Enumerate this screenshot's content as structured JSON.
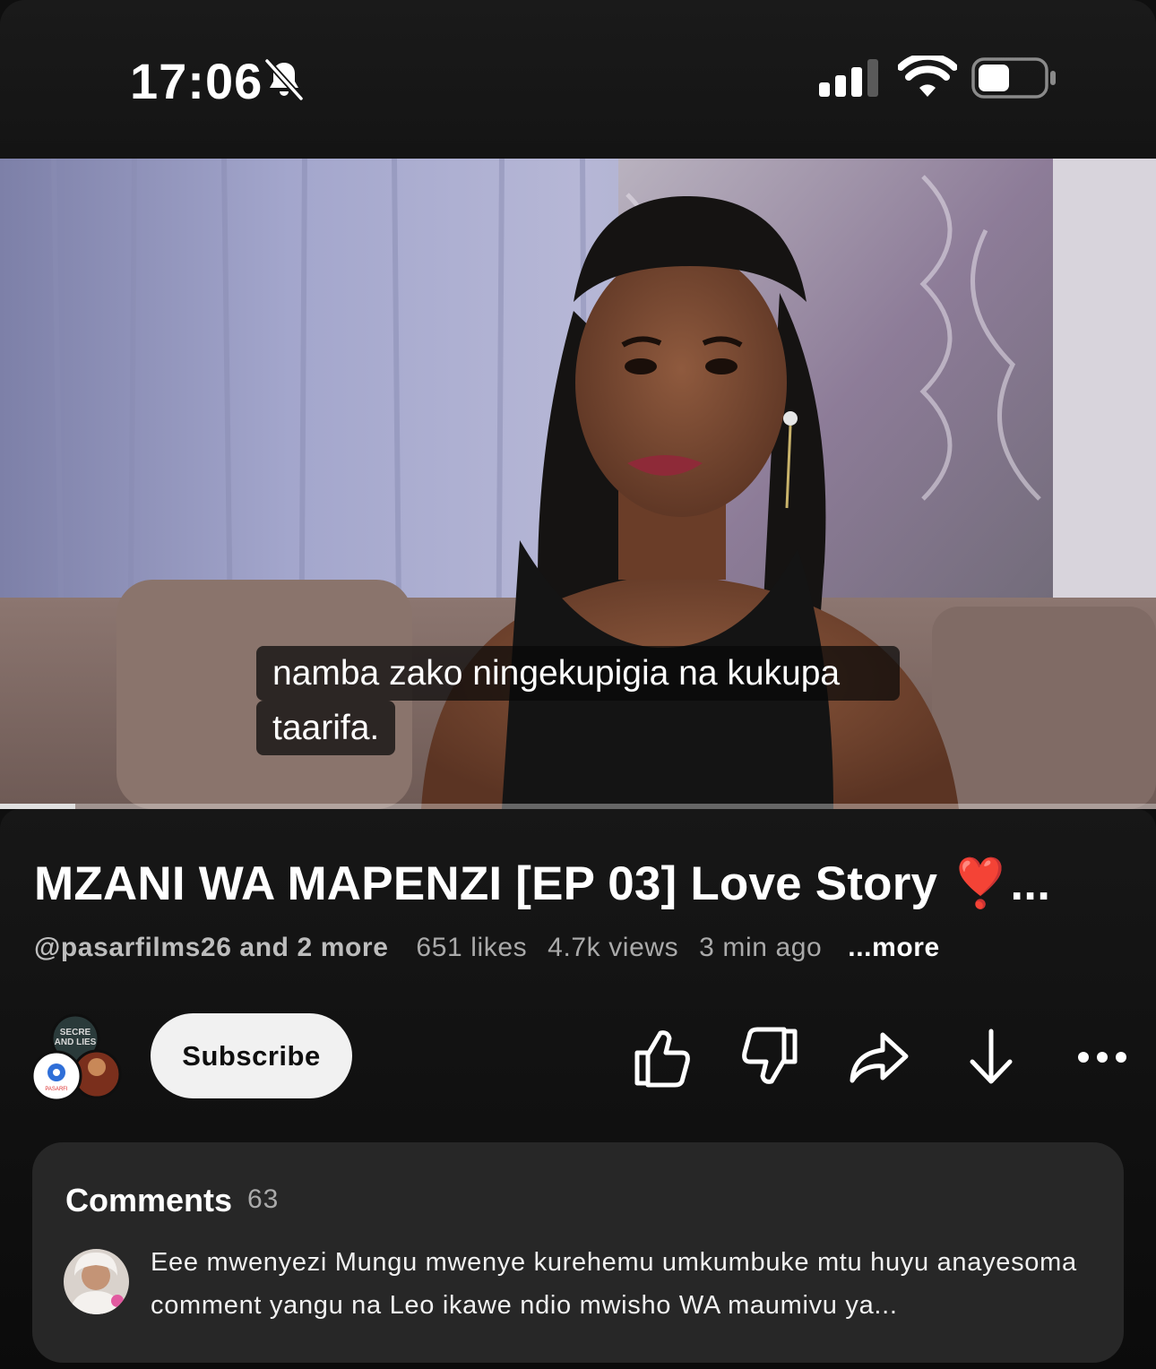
{
  "status_bar": {
    "time": "17:06",
    "icons": [
      "bell-slash-icon",
      "cellular-signal-icon",
      "wifi-icon",
      "battery-icon"
    ]
  },
  "video": {
    "caption_line1": "namba zako ningekupigia na kukupa",
    "caption_line2": "taarifa.",
    "progress_fraction": 0.065
  },
  "details": {
    "title": "MZANI WA MAPENZI [EP 03] Love Story ❣️...",
    "channel": "@pasarfilms26 and 2 more",
    "likes": "651 likes",
    "views": "4.7k views",
    "age": "3 min ago",
    "more_label": "...more"
  },
  "actions": {
    "subscribe_label": "Subscribe",
    "icons": [
      "thumbs-up-icon",
      "thumbs-down-icon",
      "share-icon",
      "download-icon",
      "more-icon"
    ]
  },
  "comments": {
    "title": "Comments",
    "count": "63",
    "top_comment": "Eee mwenyezi Mungu mwenye kurehemu umkumbuke mtu huyu anayesoma comment yangu na Leo ikawe ndio mwisho WA maumivu ya..."
  },
  "colors": {
    "background": "#0f0f0f",
    "panel": "#272727",
    "subscribe_bg": "#f1f1f1",
    "secondary_text": "#aaaaaa"
  }
}
